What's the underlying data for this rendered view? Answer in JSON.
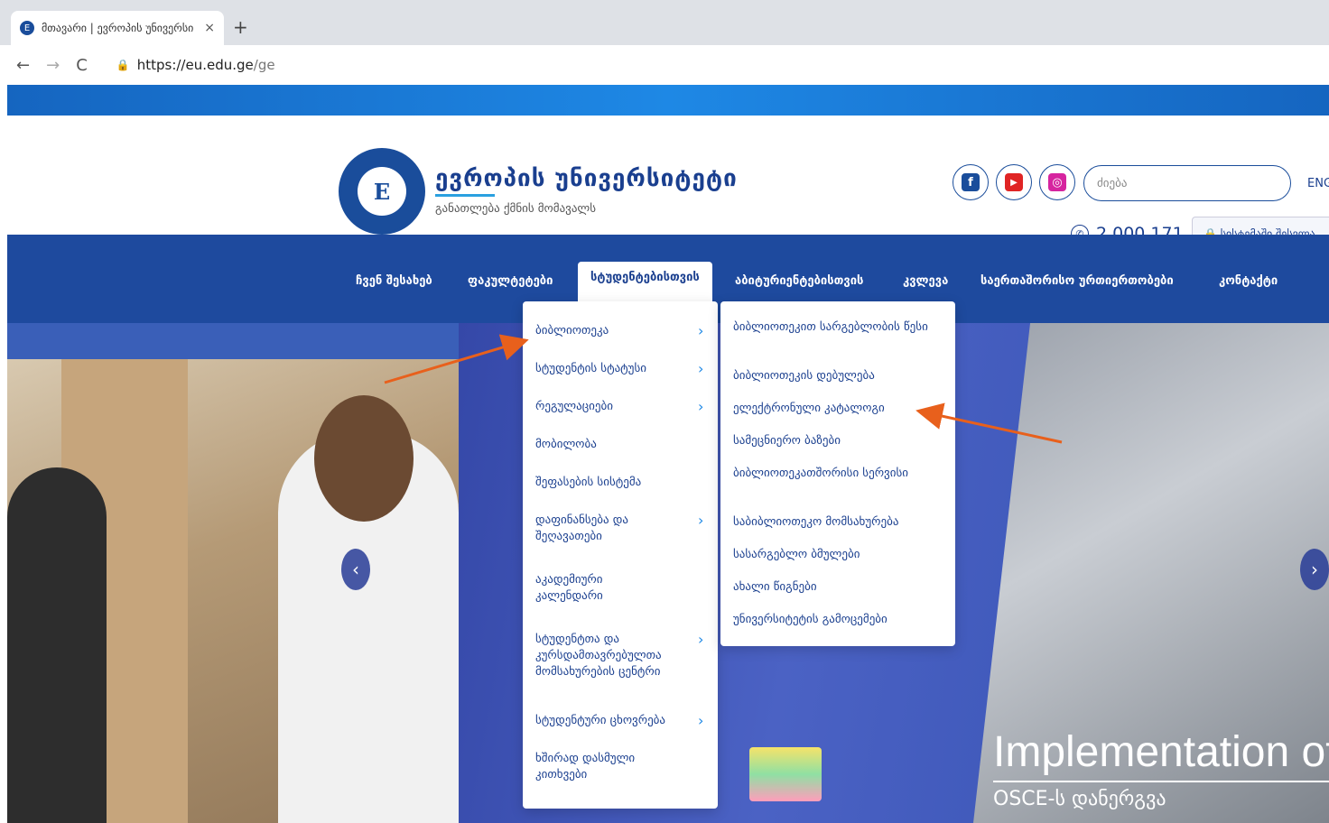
{
  "browser": {
    "tab_title": "მთავარი | ევროპის უნივერსი",
    "tab_close": "×",
    "new_tab": "+",
    "url_host": "https://eu.edu.ge",
    "url_path": "/ge",
    "back": "←",
    "forward": "→",
    "reload": "C",
    "lock": "🔒"
  },
  "header": {
    "logo_letter": "E",
    "brand_name": "ევროპის უნივერსიტეტი",
    "tagline": "განათლება ქმნის მომავალს",
    "search_placeholder": "ძიება",
    "lang": "ENG",
    "phone": "2 000 171",
    "system_login": "🔒 სისტემაში შესვლა",
    "social": {
      "facebook": "f",
      "youtube": "▶",
      "instagram": "◎"
    }
  },
  "nav": {
    "items": [
      {
        "label": "ჩვენ შესახებ"
      },
      {
        "label": "ფაკულტეტები"
      },
      {
        "label": "სტუდენტებისთვის"
      },
      {
        "label": "აბიტურიენტებისთვის"
      },
      {
        "label": "კვლევა"
      },
      {
        "label": "საერთაშორისო ურთიერთობები"
      },
      {
        "label": "კონტაქტი"
      }
    ]
  },
  "student_menu": {
    "items": [
      {
        "label": "ბიბლიოთეკა",
        "chevron": "›"
      },
      {
        "label": "სტუდენტის სტატუსი",
        "chevron": "›"
      },
      {
        "label": "რეგულაციები",
        "chevron": "›"
      },
      {
        "label": "მობილობა",
        "chevron": ""
      },
      {
        "label": "შეფასების სისტემა",
        "chevron": ""
      },
      {
        "label": "დაფინანსება და შეღავათები",
        "chevron": "›"
      },
      {
        "label": "აკადემიური კალენდარი",
        "chevron": ""
      },
      {
        "label": "სტუდენტთა და კურსდამთავრებულთა მომსახურების ცენტრი",
        "chevron": "›"
      },
      {
        "label": "სტუდენტური ცხოვრება",
        "chevron": "›"
      },
      {
        "label": "ხშირად დასმული კითხვები",
        "chevron": ""
      }
    ]
  },
  "library_menu": {
    "items": [
      {
        "label": "ბიბლიოთეკით სარგებლობის წესი"
      },
      {
        "label": "ბიბლიოთეკის დებულება"
      },
      {
        "label": "ელექტრონული კატალოგი"
      },
      {
        "label": "სამეცნიერო ბაზები"
      },
      {
        "label": "ბიბლიოთეკათშორისი სერვისი"
      },
      {
        "label": "საბიბლიოთეკო მომსახურება"
      },
      {
        "label": "სასარგებლო ბმულები"
      },
      {
        "label": "ახალი წიგნები"
      },
      {
        "label": "უნივერსიტეტის გამოცემები"
      }
    ]
  },
  "hero": {
    "caption_big": "Implementation of",
    "caption_small": "OSCE-ს დანერგვა",
    "prev": "‹",
    "next": "›"
  },
  "colors": {
    "brand_blue": "#1e4a9e",
    "accent": "#1e88e5",
    "arrow": "#e8601c"
  }
}
